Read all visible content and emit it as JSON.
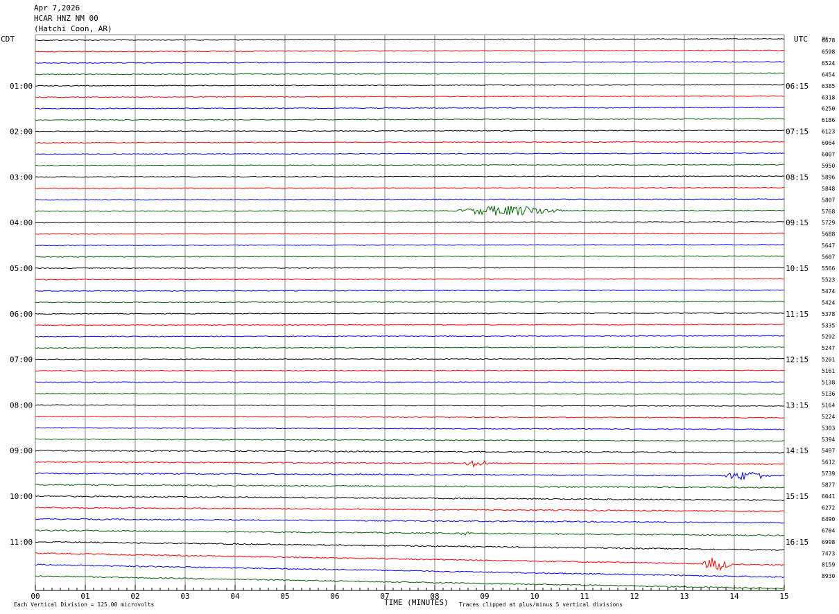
{
  "header": {
    "date": "Apr 7,2026",
    "station": "HCAR HNZ NM 00",
    "location": "(Hatchi Coon, AR)"
  },
  "left_label": "CDT",
  "right_label": "UTC",
  "dc_label": "DC",
  "footer": {
    "scale_note": "Each Vertical Division =  125.00 microvolts",
    "xlabel": "TIME (MINUTES)",
    "clip_note": "Traces clipped at plus/minus 5 vertical divisions"
  },
  "colors": {
    "black": "#000000",
    "red": "#ff0000",
    "blue": "#0000ff",
    "green": "#006400",
    "grid": "#808080"
  },
  "chart_data": {
    "type": "line",
    "title": "",
    "xlabel": "TIME (MINUTES)",
    "xlim": [
      0,
      15
    ],
    "x_ticks": [
      "00",
      "01",
      "02",
      "03",
      "04",
      "05",
      "06",
      "07",
      "08",
      "09",
      "10",
      "11",
      "12",
      "13",
      "14",
      "15"
    ],
    "trace_minutes": 15,
    "color_cycle": [
      "black",
      "red",
      "blue",
      "green"
    ],
    "left_time_labels": [
      {
        "row": 4,
        "text": "01:00"
      },
      {
        "row": 8,
        "text": "02:00"
      },
      {
        "row": 12,
        "text": "03:00"
      },
      {
        "row": 16,
        "text": "04:00"
      },
      {
        "row": 20,
        "text": "05:00"
      },
      {
        "row": 24,
        "text": "06:00"
      },
      {
        "row": 28,
        "text": "07:00"
      },
      {
        "row": 32,
        "text": "08:00"
      },
      {
        "row": 36,
        "text": "09:00"
      },
      {
        "row": 40,
        "text": "10:00"
      },
      {
        "row": 44,
        "text": "11:00"
      }
    ],
    "right_time_labels": [
      {
        "row": 4,
        "text": "06:15"
      },
      {
        "row": 8,
        "text": "07:15"
      },
      {
        "row": 12,
        "text": "08:15"
      },
      {
        "row": 16,
        "text": "09:15"
      },
      {
        "row": 20,
        "text": "10:15"
      },
      {
        "row": 24,
        "text": "11:15"
      },
      {
        "row": 28,
        "text": "12:15"
      },
      {
        "row": 32,
        "text": "13:15"
      },
      {
        "row": 36,
        "text": "14:15"
      },
      {
        "row": 40,
        "text": "15:15"
      },
      {
        "row": 44,
        "text": "16:15"
      }
    ],
    "dc_values": [
      "6678",
      "6598",
      "6524",
      "6454",
      "6385",
      "6318",
      "6250",
      "6186",
      "6123",
      "6064",
      "6007",
      "5950",
      "5896",
      "5848",
      "5807",
      "5768",
      "5729",
      "5688",
      "5647",
      "5607",
      "5566",
      "5523",
      "5474",
      "5424",
      "5378",
      "5335",
      "5292",
      "5247",
      "5201",
      "5161",
      "5138",
      "5136",
      "5164",
      "5224",
      "5303",
      "5394",
      "5497",
      "5612",
      "5739",
      "5877",
      "6041",
      "6272",
      "6490",
      "6704",
      "6998",
      "7473",
      "8159",
      "8930"
    ],
    "events": [
      {
        "row": 15,
        "center_min": 9.5,
        "width_min": 2.2,
        "amplitude": 7
      },
      {
        "row": 37,
        "center_min": 8.85,
        "width_min": 0.5,
        "amplitude": 5
      },
      {
        "row": 38,
        "center_min": 14.25,
        "width_min": 1.0,
        "amplitude": 6
      },
      {
        "row": 43,
        "center_min": 8.6,
        "width_min": 0.2,
        "amplitude": 3
      },
      {
        "row": 45,
        "center_min": 13.65,
        "width_min": 0.6,
        "amplitude": 9
      }
    ]
  }
}
